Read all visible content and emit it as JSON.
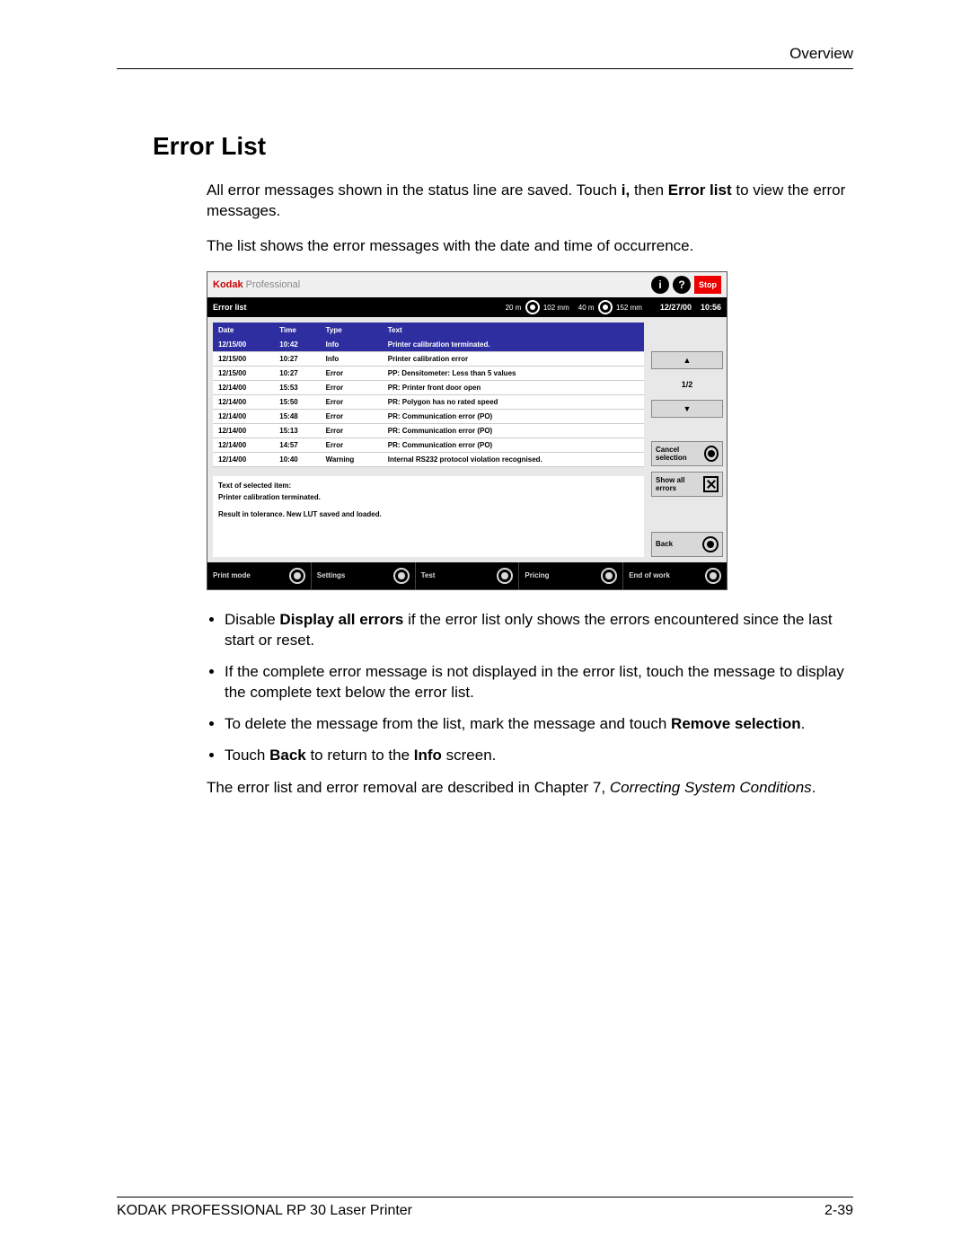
{
  "header": {
    "section": "Overview"
  },
  "title": "Error List",
  "intro": {
    "p1a": "All error messages shown in the status line are saved. Touch ",
    "p1b": "i,",
    "p1c": " then ",
    "p1d": "Error list",
    "p1e": " to view the error messages.",
    "p2": "The list shows the error messages with the date and time of occurrence."
  },
  "screenshot": {
    "brand_a": "Kodak",
    "brand_b": " Professional",
    "info_icon": "i",
    "help_icon": "?",
    "stop": "Stop",
    "bar_title": "Error list",
    "paper1": "20 m",
    "paper1b": "102 mm",
    "paper2": "40 m",
    "paper2b": "152 mm",
    "date": "12/27/00",
    "time": "10:56",
    "columns": {
      "date": "Date",
      "time": "Time",
      "type": "Type",
      "text": "Text"
    },
    "rows": [
      {
        "date": "12/15/00",
        "time": "10:42",
        "type": "Info",
        "text": "Printer calibration terminated."
      },
      {
        "date": "12/15/00",
        "time": "10:27",
        "type": "Info",
        "text": "Printer calibration error"
      },
      {
        "date": "12/15/00",
        "time": "10:27",
        "type": "Error",
        "text": "PP: Densitometer: Less than 5 values"
      },
      {
        "date": "12/14/00",
        "time": "15:53",
        "type": "Error",
        "text": "PR: Printer front door open"
      },
      {
        "date": "12/14/00",
        "time": "15:50",
        "type": "Error",
        "text": "PR: Polygon has no rated speed"
      },
      {
        "date": "12/14/00",
        "time": "15:48",
        "type": "Error",
        "text": "PR: Communication error (PO)"
      },
      {
        "date": "12/14/00",
        "time": "15:13",
        "type": "Error",
        "text": "PR: Communication error (PO)"
      },
      {
        "date": "12/14/00",
        "time": "14:57",
        "type": "Error",
        "text": "PR: Communication error (PO)"
      },
      {
        "date": "12/14/00",
        "time": "10:40",
        "type": "Warning",
        "text": "Internal RS232 protocol violation recognised."
      }
    ],
    "page_indicator": "1/2",
    "detail_label": "Text of selected item:",
    "detail_text": "Printer calibration terminated.",
    "detail_result": "Result in tolerance. New LUT saved and loaded.",
    "side": {
      "cancel": "Cancel selection",
      "showall": "Show all errors",
      "back": "Back"
    },
    "bottom": {
      "print": "Print mode",
      "settings": "Settings",
      "test": "Test",
      "pricing": "Pricing",
      "end": "End of work"
    }
  },
  "bullets": {
    "b1a": "Disable ",
    "b1b": "Display all errors",
    "b1c": " if the error list only shows the errors encountered since the last start or reset.",
    "b2": "If the complete error message is not displayed in the error list, touch the message to display the complete text below the error list.",
    "b3a": "To delete the message from the list, mark the message and touch ",
    "b3b": "Remove selection",
    "b3c": ".",
    "b4a": "Touch ",
    "b4b": "Back",
    "b4c": " to return to the ",
    "b4d": "Info",
    "b4e": " screen."
  },
  "closing": {
    "a": "The error list and error removal are described in Chapter 7, ",
    "b": "Correcting System Conditions",
    "c": "."
  },
  "footer": {
    "left": "KODAK PROFESSIONAL RP 30 Laser Printer",
    "right": "2-39"
  }
}
